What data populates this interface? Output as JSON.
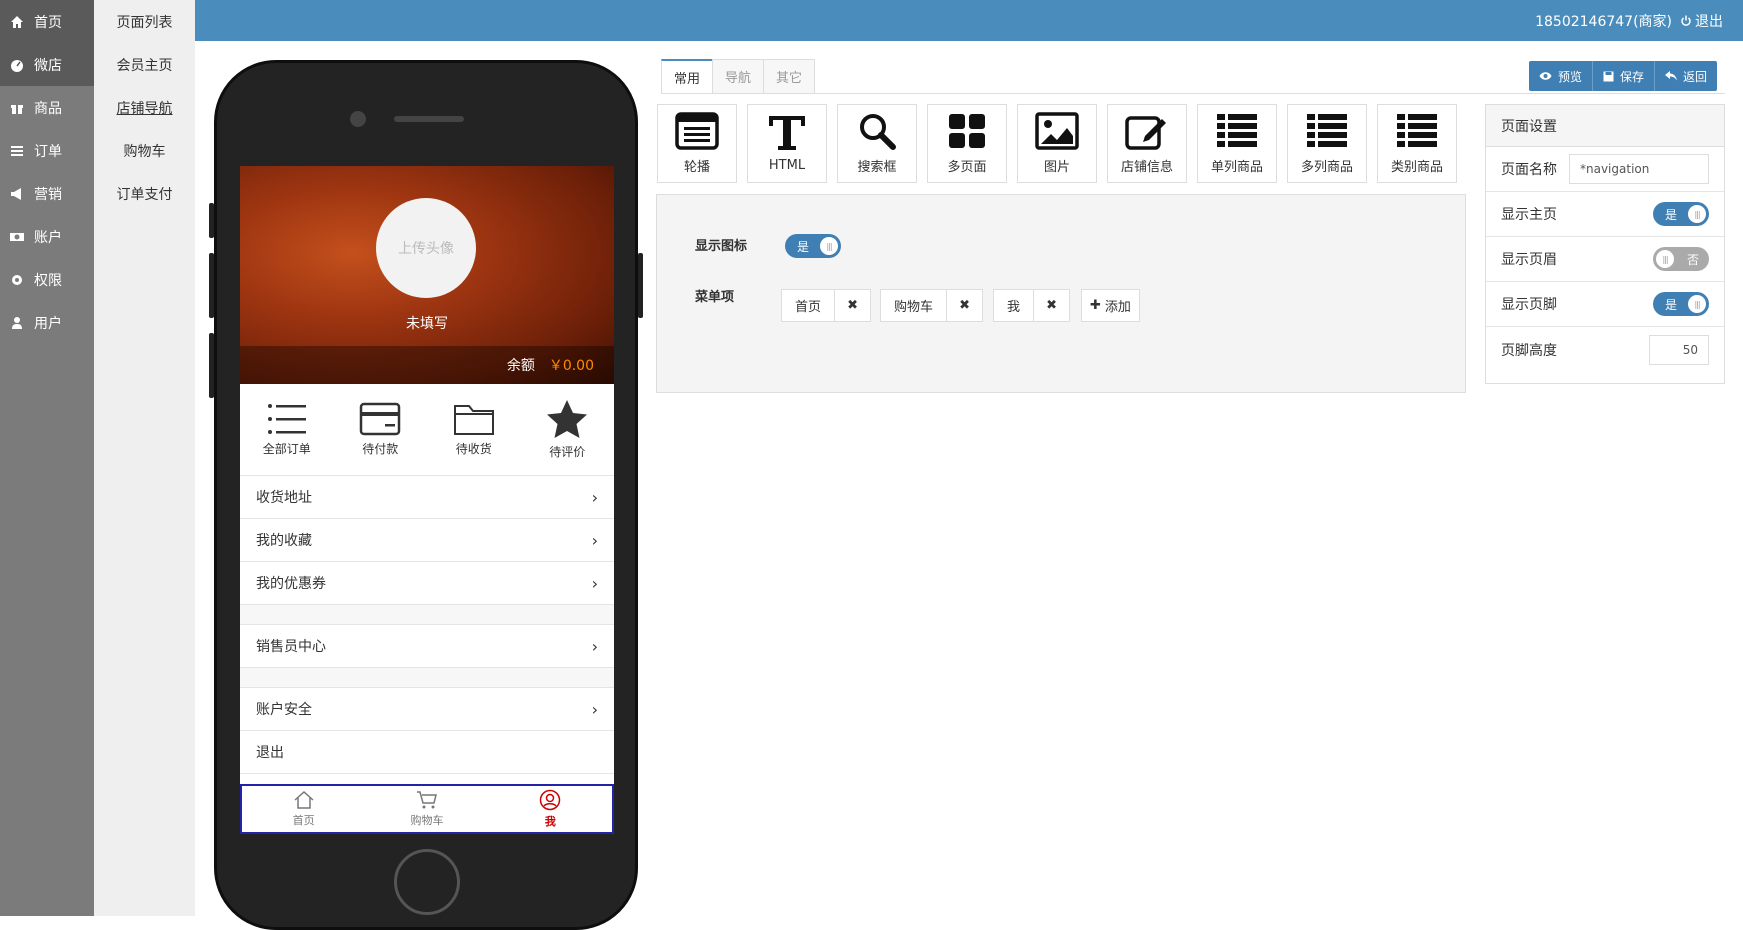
{
  "left_nav": [
    {
      "label": "首页",
      "icon": "home-icon"
    },
    {
      "label": "微店",
      "icon": "dashboard-icon"
    },
    {
      "label": "商品",
      "icon": "gift-icon"
    },
    {
      "label": "订单",
      "icon": "list-icon"
    },
    {
      "label": "营销",
      "icon": "bullhorn-icon"
    },
    {
      "label": "账户",
      "icon": "money-icon"
    },
    {
      "label": "权限",
      "icon": "gear-icon"
    },
    {
      "label": "用户",
      "icon": "user-icon"
    }
  ],
  "sub_nav": [
    "页面列表",
    "会员主页",
    "店铺导航",
    "购物车",
    "订单支付"
  ],
  "topbar": {
    "user": "18502146747(商家)",
    "logout": "退出"
  },
  "phone": {
    "avatar": "上传头像",
    "name": "未填写",
    "balance_label": "余额",
    "balance_value": "￥0.00",
    "orders": [
      "全部订单",
      "待付款",
      "待收货",
      "待评价"
    ],
    "menu": [
      "收货地址",
      "我的收藏",
      "我的优惠券",
      "销售员中心",
      "账户安全",
      "退出"
    ],
    "tabbar": [
      "首页",
      "购物车",
      "我"
    ]
  },
  "tabs": [
    "常用",
    "导航",
    "其它"
  ],
  "actions": {
    "preview": "预览",
    "save": "保存",
    "back": "返回"
  },
  "tools": [
    "轮播",
    "HTML",
    "搜索框",
    "多页面",
    "图片",
    "店铺信息",
    "单列商品",
    "多列商品",
    "类别商品"
  ],
  "panel": {
    "show_icon_label": "显示图标",
    "show_icon_value": "是",
    "menu_label": "菜单项",
    "items": [
      "首页",
      "购物车",
      "我"
    ],
    "add": "添加"
  },
  "settings": {
    "title": "页面设置",
    "name_label": "页面名称",
    "name_value": "*navigation",
    "home_label": "显示主页",
    "home_value": "是",
    "header_label": "显示页眉",
    "header_value": "否",
    "footer_label": "显示页脚",
    "footer_value": "是",
    "footer_height_label": "页脚高度",
    "footer_height_value": "50"
  },
  "colors": {
    "topbar": "#4a8dbc",
    "accent": "#3f7fb3",
    "balance": "#ff8a00",
    "active_tab": "#cc0000"
  }
}
